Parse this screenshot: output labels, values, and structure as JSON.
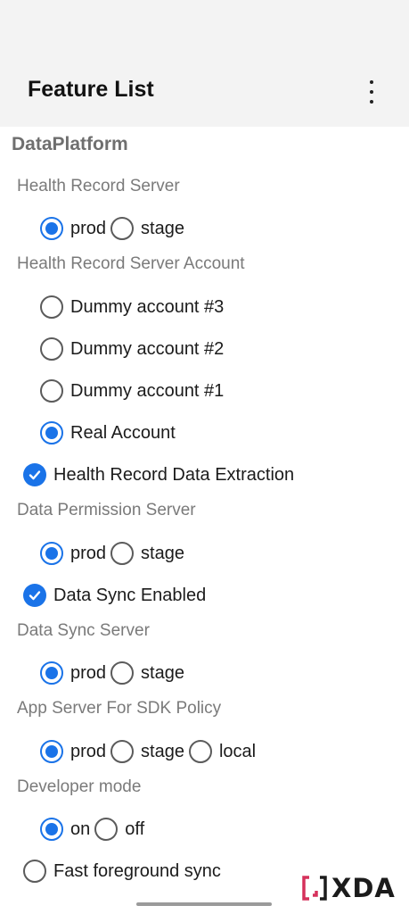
{
  "app_bar": {
    "title": "Feature List",
    "menu_icon": "more-vert-icon"
  },
  "section": {
    "title": "DataPlatform"
  },
  "health_record_server": {
    "label": "Health Record Server",
    "options": [
      {
        "label": "prod",
        "selected": true
      },
      {
        "label": "stage",
        "selected": false
      }
    ]
  },
  "health_record_server_account": {
    "label": "Health Record Server Account",
    "options": [
      {
        "label": "Dummy account #3",
        "selected": false
      },
      {
        "label": "Dummy account #2",
        "selected": false
      },
      {
        "label": "Dummy account #1",
        "selected": false
      },
      {
        "label": "Real Account",
        "selected": true
      }
    ]
  },
  "health_record_data_extraction": {
    "label": "Health Record Data Extraction",
    "checked": true
  },
  "data_permission_server": {
    "label": "Data Permission Server",
    "options": [
      {
        "label": "prod",
        "selected": true
      },
      {
        "label": "stage",
        "selected": false
      }
    ]
  },
  "data_sync_enabled": {
    "label": "Data Sync Enabled",
    "checked": true
  },
  "data_sync_server": {
    "label": "Data Sync Server",
    "options": [
      {
        "label": "prod",
        "selected": true
      },
      {
        "label": "stage",
        "selected": false
      }
    ]
  },
  "app_server_sdk_policy": {
    "label": "App Server For SDK Policy",
    "options": [
      {
        "label": "prod",
        "selected": true
      },
      {
        "label": "stage",
        "selected": false
      },
      {
        "label": "local",
        "selected": false
      }
    ]
  },
  "developer_mode": {
    "label": "Developer mode",
    "options": [
      {
        "label": "on",
        "selected": true
      },
      {
        "label": "off",
        "selected": false
      }
    ]
  },
  "fast_foreground_sync": {
    "label": "Fast foreground sync",
    "selected": false
  },
  "watermark": {
    "text": "XDA"
  },
  "colors": {
    "accent": "#1a73e8",
    "app_bar_bg": "#f3f3f3",
    "section_text": "#6f6f6f",
    "label_text": "#7a7a7a"
  }
}
